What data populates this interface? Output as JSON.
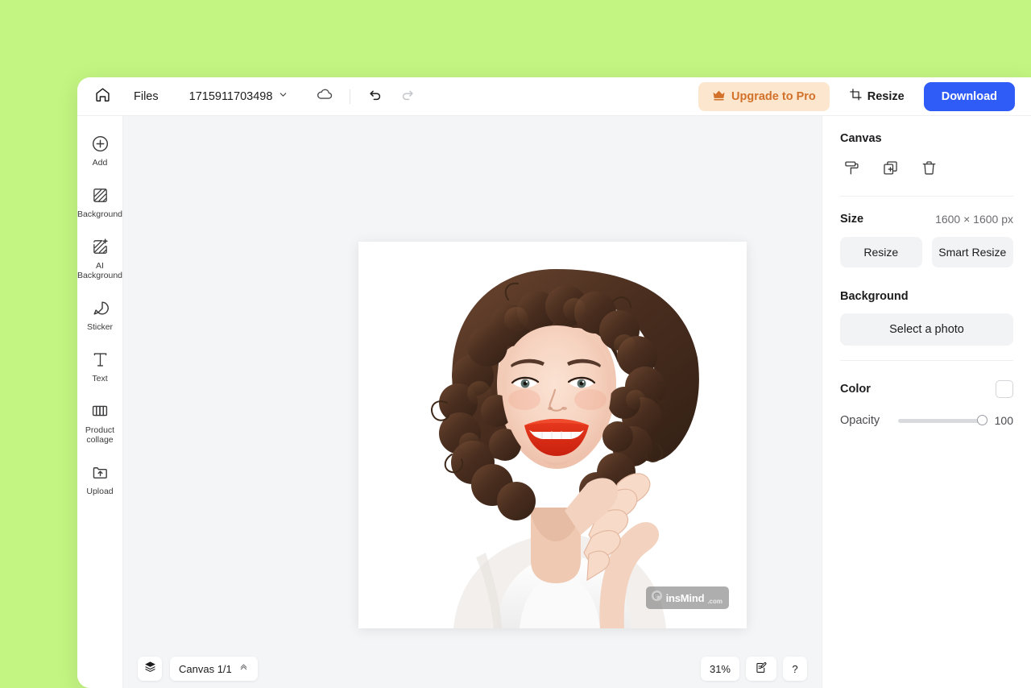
{
  "theme": {
    "page_background": "#C3F582",
    "accent_blue": "#2F5BF6",
    "upgrade_bg": "#FCE6CD",
    "upgrade_fg": "#D2712A",
    "canvas_gray": "#F4F5F7"
  },
  "topbar": {
    "home_icon": "home-icon",
    "files_label": "Files",
    "document_title": "1715911703498",
    "title_chevron_icon": "chevron-down-icon",
    "cloud_icon": "cloud-save-icon",
    "undo_icon": "undo-arrow-icon",
    "redo_icon": "redo-arrow-icon",
    "upgrade_label": "Upgrade to Pro",
    "upgrade_icon": "crown-icon",
    "resize_label": "Resize",
    "resize_icon": "crop-frame-icon",
    "download_label": "Download"
  },
  "sidebar": {
    "items": [
      {
        "label": "Add",
        "icon": "plus-circle-icon"
      },
      {
        "label": "Background",
        "icon": "hatch-square-icon"
      },
      {
        "label": "AI\nBackground",
        "icon": "hatch-sparkle-icon"
      },
      {
        "label": "Sticker",
        "icon": "sticker-peel-icon"
      },
      {
        "label": "Text",
        "icon": "text-t-icon"
      },
      {
        "label": "Product\ncollage",
        "icon": "collage-panels-icon"
      },
      {
        "label": "Upload",
        "icon": "upload-folder-icon"
      }
    ]
  },
  "canvas": {
    "watermark_text": "insMind",
    "watermark_suffix": ".com",
    "watermark_icon": "insmind-spiral-logo-icon",
    "image_alt": "smiling-woman-portrait"
  },
  "bottombar": {
    "layers_icon": "layers-stack-icon",
    "canvas_pager_label": "Canvas 1/1",
    "pager_chevron_icon": "chevron-up-double-icon",
    "zoom_level": "31%",
    "feedback_icon": "feedback-note-icon",
    "help_label": "?"
  },
  "rightpanel": {
    "title": "Canvas",
    "tools": [
      {
        "icon": "paint-roller-icon",
        "name": "fill-tool"
      },
      {
        "icon": "duplicate-plus-icon",
        "name": "duplicate-tool"
      },
      {
        "icon": "trash-bin-icon",
        "name": "delete-tool"
      }
    ],
    "size_label": "Size",
    "size_value": "1600 × 1600 px",
    "resize_label": "Resize",
    "smart_resize_label": "Smart Resize",
    "background_label": "Background",
    "select_photo_label": "Select a photo",
    "color_label": "Color",
    "color_value": "#FFFFFF",
    "opacity_label": "Opacity",
    "opacity_value": "100"
  }
}
